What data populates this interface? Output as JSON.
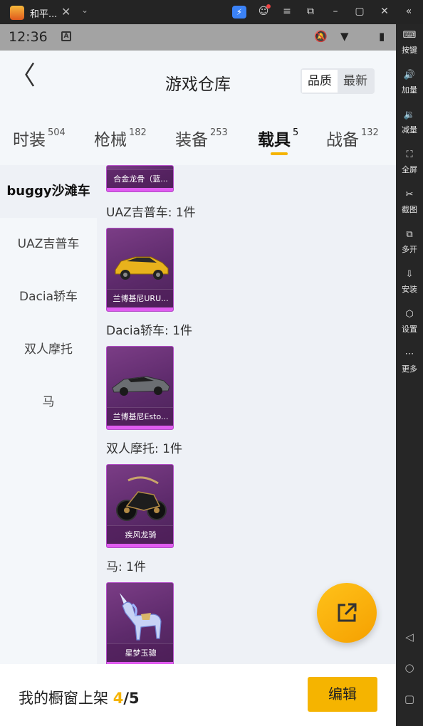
{
  "window": {
    "app_title": "和平...",
    "close_glyph": "✕",
    "chevron_glyph": "⌄",
    "buttons": [
      "⚡",
      "☺",
      "≡",
      "⧉",
      "–",
      "▢",
      "✕",
      "«"
    ]
  },
  "status_bar": {
    "time": "12:36",
    "a_badge": "A",
    "icons": [
      "🔕",
      "▼",
      "▮"
    ]
  },
  "header": {
    "back_glyph": "〈",
    "title": "游戏仓库",
    "sort_options": [
      "品质",
      "最新"
    ],
    "active_sort": "品质"
  },
  "tabs": [
    {
      "label": "时装",
      "count": "504"
    },
    {
      "label": "枪械",
      "count": "182"
    },
    {
      "label": "装备",
      "count": "253"
    },
    {
      "label": "载具",
      "count": "5",
      "active": true
    },
    {
      "label": "战备",
      "count": "132"
    }
  ],
  "left_nav": [
    {
      "label": "buggy沙滩车",
      "active": true
    },
    {
      "label": "UAZ吉普车"
    },
    {
      "label": "Dacia轿车"
    },
    {
      "label": "双人摩托"
    },
    {
      "label": "马"
    }
  ],
  "sections": [
    {
      "title": "",
      "item_name": "合金龙骨（蓝...",
      "icon": "buggy-icon"
    },
    {
      "title": "UAZ吉普车: 1件",
      "item_name": "兰博基尼URU...",
      "icon": "yellow-suv-icon"
    },
    {
      "title": "Dacia轿车: 1件",
      "item_name": "兰博基尼Esto...",
      "icon": "grey-sedan-icon"
    },
    {
      "title": "双人摩托: 1件",
      "item_name": "疾风龙骑",
      "icon": "motorcycle-icon"
    },
    {
      "title": "马: 1件",
      "item_name": "星梦玉骢",
      "icon": "unicorn-icon"
    }
  ],
  "fab": {
    "icon": "share-external-icon"
  },
  "bottom_bar": {
    "label": "我的橱窗上架 ",
    "used": "4",
    "slash": "/",
    "total": "5",
    "edit_label": "编辑"
  },
  "sidebar": [
    {
      "icon": "⌨",
      "label": "按键"
    },
    {
      "icon": "🔊",
      "label": "加量"
    },
    {
      "icon": "🔉",
      "label": "减量"
    },
    {
      "icon": "⛶",
      "label": "全屏"
    },
    {
      "icon": "✂",
      "label": "截图"
    },
    {
      "icon": "⧉",
      "label": "多开"
    },
    {
      "icon": "⇩",
      "label": "安装"
    },
    {
      "icon": "⬡",
      "label": "设置"
    },
    {
      "icon": "⋯",
      "label": "更多"
    }
  ],
  "android_nav": [
    "◁",
    "○",
    "▢"
  ],
  "colors": {
    "accent": "#f5b400",
    "card_purple": "#6a2f78",
    "card_border": "#b44dc8",
    "badge_bolt": "#3b82f6"
  }
}
